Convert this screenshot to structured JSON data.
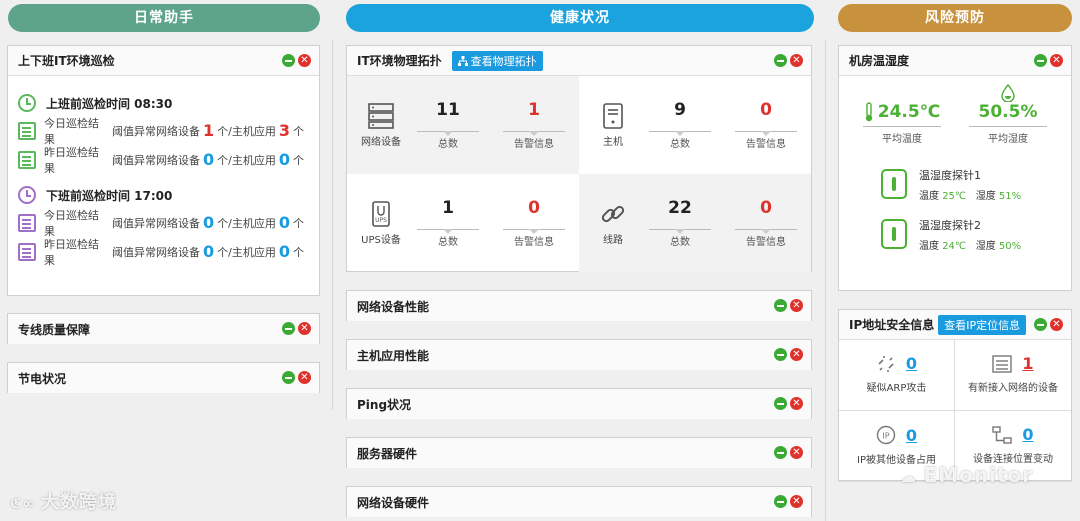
{
  "columns": {
    "left": {
      "title": "日常助手",
      "color": "#5ea48a"
    },
    "mid": {
      "title": "健康状况",
      "color": "#1aa3dc"
    },
    "right": {
      "title": "风险预防",
      "color": "#c8913d"
    }
  },
  "inspection": {
    "title": "上下班IT环境巡检",
    "morning": {
      "title": "上班前巡检时间 08:30",
      "today": {
        "label": "今日巡检结果",
        "prefix": "阈值异常网络设备",
        "net": "1",
        "mid": "个/主机应用",
        "app": "3",
        "suffix": "个"
      },
      "yesterday": {
        "label": "昨日巡检结果",
        "prefix": "阈值异常网络设备",
        "net": "0",
        "mid": "个/主机应用",
        "app": "0",
        "suffix": "个"
      }
    },
    "evening": {
      "title": "下班前巡检时间 17:00",
      "today": {
        "label": "今日巡检结果",
        "prefix": "阈值异常网络设备",
        "net": "0",
        "mid": "个/主机应用",
        "app": "0",
        "suffix": "个"
      },
      "yesterday": {
        "label": "昨日巡检结果",
        "prefix": "阈值异常网络设备",
        "net": "0",
        "mid": "个/主机应用",
        "app": "0",
        "suffix": "个"
      }
    }
  },
  "left_panels": [
    "专线质量保障",
    "节电状况"
  ],
  "topology": {
    "title": "IT环境物理拓扑",
    "button": "查看物理拓扑",
    "total_label": "总数",
    "alarm_label": "告警信息",
    "cells": [
      {
        "name": "网络设备",
        "total": "11",
        "alarm": "1",
        "alarm_red": true,
        "icon": "server-icon"
      },
      {
        "name": "主机",
        "total": "9",
        "alarm": "0",
        "alarm_red": true,
        "icon": "host-icon"
      },
      {
        "name": "UPS设备",
        "total": "1",
        "alarm": "0",
        "alarm_red": true,
        "icon": "ups-icon"
      },
      {
        "name": "线路",
        "total": "22",
        "alarm": "0",
        "alarm_red": true,
        "icon": "link-icon"
      }
    ]
  },
  "mid_panels": [
    "网络设备性能",
    "主机应用性能",
    "Ping状况",
    "服务器硬件",
    "网络设备硬件"
  ],
  "room": {
    "title": "机房温湿度",
    "avg_temp": "24.5℃",
    "avg_temp_label": "平均温度",
    "avg_hum": "50.5%",
    "avg_hum_label": "平均湿度",
    "probes": [
      {
        "name": "温湿度探针1",
        "temp_label": "温度",
        "temp": "25℃",
        "hum_label": "湿度",
        "hum": "51%"
      },
      {
        "name": "温湿度探针2",
        "temp_label": "温度",
        "temp": "24℃",
        "hum_label": "湿度",
        "hum": "50%"
      }
    ]
  },
  "ipsec": {
    "title": "IP地址安全信息",
    "button": "查看IP定位信息",
    "cells": [
      {
        "value": "0",
        "label": "疑似ARP攻击",
        "red": false
      },
      {
        "value": "1",
        "label": "有新接入网络的设备",
        "red": true
      },
      {
        "value": "0",
        "label": "IP被其他设备占用",
        "red": false
      },
      {
        "value": "0",
        "label": "设备连接位置变动",
        "red": false
      }
    ]
  },
  "watermarks": {
    "left": "大数跨境",
    "right": "EMonitor"
  }
}
